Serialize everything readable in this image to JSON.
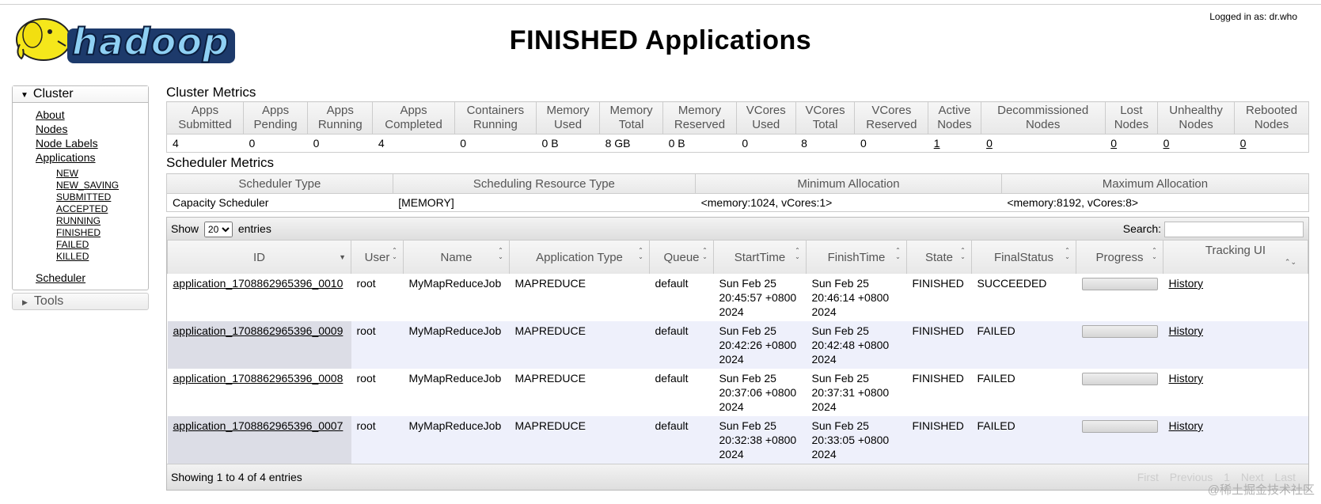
{
  "header": {
    "title": "FINISHED Applications",
    "logged_in": "Logged in as: dr.who",
    "logo_text": "hadoop"
  },
  "nav": {
    "cluster_label": "Cluster",
    "links": [
      "About",
      "Nodes",
      "Node Labels",
      "Applications"
    ],
    "sub_links": [
      "NEW",
      "NEW_SAVING",
      "SUBMITTED",
      "ACCEPTED",
      "RUNNING",
      "FINISHED",
      "FAILED",
      "KILLED"
    ],
    "scheduler_label": "Scheduler",
    "tools_label": "Tools"
  },
  "cluster_metrics": {
    "title": "Cluster Metrics",
    "headers": [
      [
        "Apps",
        "Submitted"
      ],
      [
        "Apps",
        "Pending"
      ],
      [
        "Apps",
        "Running"
      ],
      [
        "Apps",
        "Completed"
      ],
      [
        "Containers",
        "Running"
      ],
      [
        "Memory",
        "Used"
      ],
      [
        "Memory",
        "Total"
      ],
      [
        "Memory",
        "Reserved"
      ],
      [
        "VCores",
        "Used"
      ],
      [
        "VCores",
        "Total"
      ],
      [
        "VCores",
        "Reserved"
      ],
      [
        "Active",
        "Nodes"
      ],
      [
        "Decommissioned",
        "Nodes"
      ],
      [
        "Lost",
        "Nodes"
      ],
      [
        "Unhealthy",
        "Nodes"
      ],
      [
        "Rebooted",
        "Nodes"
      ]
    ],
    "values": [
      "4",
      "0",
      "0",
      "4",
      "0",
      "0 B",
      "8 GB",
      "0 B",
      "0",
      "8",
      "0",
      "1",
      "0",
      "0",
      "0",
      "0"
    ]
  },
  "scheduler_metrics": {
    "title": "Scheduler Metrics",
    "headers": [
      "Scheduler Type",
      "Scheduling Resource Type",
      "Minimum Allocation",
      "Maximum Allocation"
    ],
    "values": [
      "Capacity Scheduler",
      "[MEMORY]",
      "<memory:1024, vCores:1>",
      "<memory:8192, vCores:8>"
    ]
  },
  "apps_table": {
    "show_label": "Show",
    "entries_value": "20",
    "entries_label": "entries",
    "search_label": "Search:",
    "columns": [
      "ID",
      "User",
      "Name",
      "Application Type",
      "Queue",
      "StartTime",
      "FinishTime",
      "State",
      "FinalStatus",
      "Progress",
      "Tracking UI"
    ],
    "rows": [
      {
        "id": "application_1708862965396_0010",
        "user": "root",
        "name": "MyMapReduceJob",
        "type": "MAPREDUCE",
        "queue": "default",
        "start": [
          "Sun Feb 25",
          "20:45:57 +0800",
          "2024"
        ],
        "finish": [
          "Sun Feb 25",
          "20:46:14 +0800",
          "2024"
        ],
        "state": "FINISHED",
        "final": "SUCCEEDED",
        "tracking": "History"
      },
      {
        "id": "application_1708862965396_0009",
        "user": "root",
        "name": "MyMapReduceJob",
        "type": "MAPREDUCE",
        "queue": "default",
        "start": [
          "Sun Feb 25",
          "20:42:26 +0800",
          "2024"
        ],
        "finish": [
          "Sun Feb 25",
          "20:42:48 +0800",
          "2024"
        ],
        "state": "FINISHED",
        "final": "FAILED",
        "tracking": "History"
      },
      {
        "id": "application_1708862965396_0008",
        "user": "root",
        "name": "MyMapReduceJob",
        "type": "MAPREDUCE",
        "queue": "default",
        "start": [
          "Sun Feb 25",
          "20:37:06 +0800",
          "2024"
        ],
        "finish": [
          "Sun Feb 25",
          "20:37:31 +0800",
          "2024"
        ],
        "state": "FINISHED",
        "final": "FAILED",
        "tracking": "History"
      },
      {
        "id": "application_1708862965396_0007",
        "user": "root",
        "name": "MyMapReduceJob",
        "type": "MAPREDUCE",
        "queue": "default",
        "start": [
          "Sun Feb 25",
          "20:32:38 +0800",
          "2024"
        ],
        "finish": [
          "Sun Feb 25",
          "20:33:05 +0800",
          "2024"
        ],
        "state": "FINISHED",
        "final": "FAILED",
        "tracking": "History"
      }
    ],
    "footer_info": "Showing 1 to 4 of 4 entries",
    "pager": [
      "First",
      "Previous",
      "1",
      "Next",
      "Last"
    ]
  },
  "watermark": "@稀土掘金技术社区"
}
